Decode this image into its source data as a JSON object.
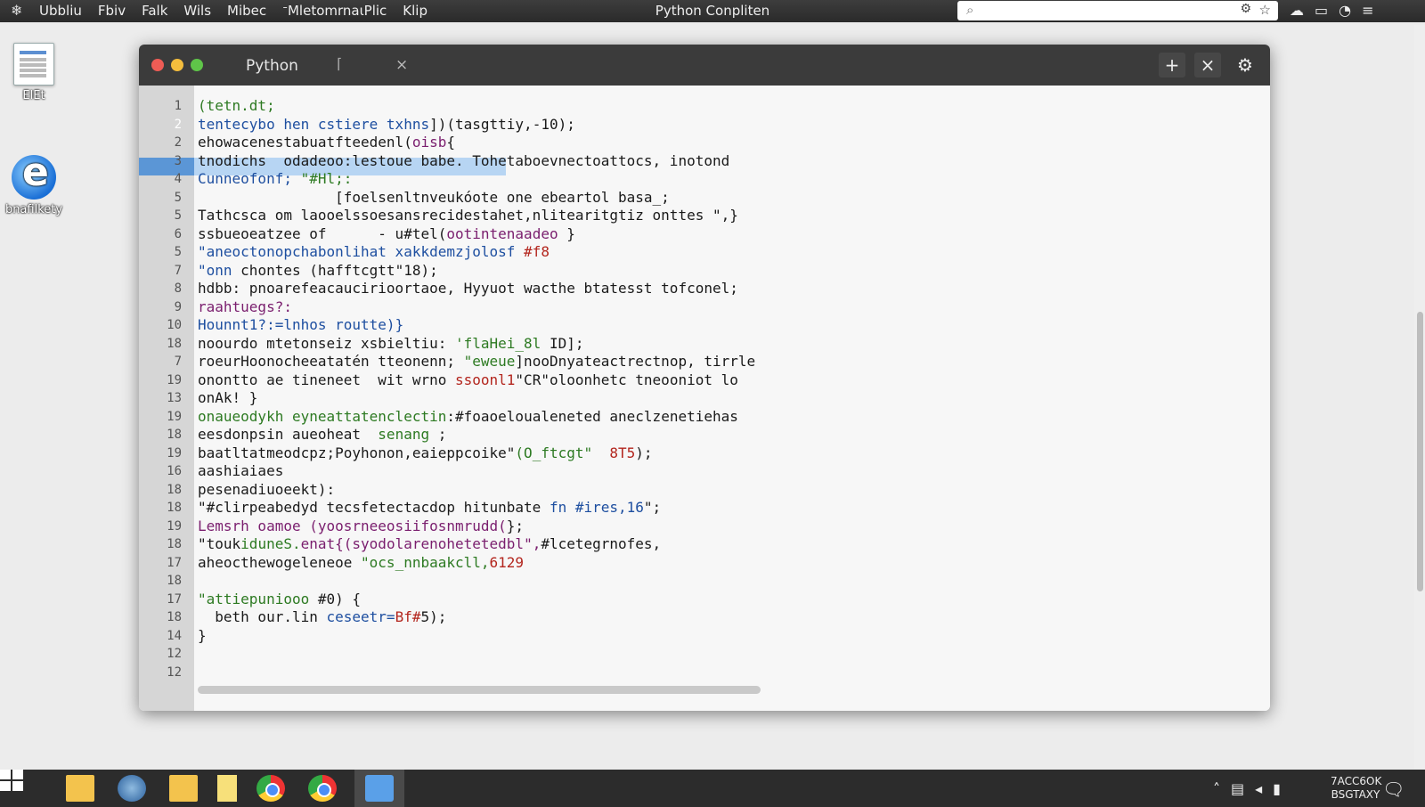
{
  "menubar": {
    "items": [
      "Ubbliu",
      "Fbiv",
      "Falk",
      "Wils",
      "Mibec",
      "ᐨMletomrnaιPlic",
      "Klip"
    ],
    "title": "Python Conpliten"
  },
  "desktop": {
    "icons": [
      {
        "label": "ElEt"
      },
      {
        "label": "bnafilkety"
      }
    ]
  },
  "window": {
    "tab_title": "Python",
    "tab_pin": "⌈",
    "tab_close": "×",
    "btn_pin": "+",
    "btn_close": "×",
    "btn_gear": "⚙"
  },
  "editor": {
    "line_numbers": [
      "1",
      "2",
      "2",
      "3",
      "4",
      "5",
      "5",
      "6",
      "5",
      "7",
      "8",
      "9",
      "10",
      "18",
      "7",
      "19",
      "13",
      "19",
      "18",
      "19",
      "16",
      "18",
      "18",
      "19",
      "18",
      "17",
      "18",
      "17",
      "18",
      "14",
      "12",
      "12"
    ],
    "lines": [
      [
        {
          "t": "(tetn.dt;",
          "c": "g"
        }
      ],
      [
        {
          "t": "tentecybo hen cstiere txhns",
          "c": "b"
        },
        {
          "t": "])(tasgttiy,-10);",
          "c": "k"
        }
      ],
      [
        {
          "t": "ehowacenestabuatfteedenl(",
          "c": "k"
        },
        {
          "t": "oisb",
          "c": "p"
        },
        {
          "t": "{",
          "c": "k"
        }
      ],
      [
        {
          "t": "tnodichs  odadeoo:lestoue babe. Tohetaboevnectoattocs, inotond",
          "c": "k"
        }
      ],
      [
        {
          "t": "Cunneofonf; ",
          "c": "b"
        },
        {
          "t": "\"#Hl;:",
          "c": "g"
        }
      ],
      [
        {
          "t": "                [foelsenltnveukóote one ebeartol basa_;",
          "c": "k"
        }
      ],
      [
        {
          "t": "Tathcsca om laooelssoesansrecidestahet,nlitearitgtiz onttes \",}",
          "c": "k"
        }
      ],
      [
        {
          "t": "ssbueoeatzee of      - u#tel(",
          "c": "k"
        },
        {
          "t": "ootintenaadeo",
          "c": "p"
        },
        {
          "t": " }",
          "c": "k"
        }
      ],
      [
        {
          "t": "\"aneoctonopchabonlihat xakkdemzjolosf ",
          "c": "b"
        },
        {
          "t": "#f8",
          "c": "r"
        }
      ],
      [
        {
          "t": "\"onn ",
          "c": "b"
        },
        {
          "t": "chontes (hafftcgtt\"18);",
          "c": "k"
        }
      ],
      [
        {
          "t": "hdbb: pnoarefeacaucirioortaoe, Hyyuot wacthe btatesst tofconel;",
          "c": "k"
        }
      ],
      [
        {
          "t": "raahtuegs?:",
          "c": "p"
        }
      ],
      [
        {
          "t": "Hounnt1?:",
          "c": "b"
        },
        {
          "t": "=lnhos routte)}",
          "c": "b"
        }
      ],
      [
        {
          "t": "noourdo mtetonseiz xsbieltiu: ",
          "c": "k"
        },
        {
          "t": "'flaHei_8l",
          "c": "g"
        },
        {
          "t": " ID];",
          "c": "k"
        }
      ],
      [
        {
          "t": "roeurHoonocheeatatén tteonenn; ",
          "c": "k"
        },
        {
          "t": "\"eweue",
          "c": "g"
        },
        {
          "t": "]nooDnyateactrectnop, tirrle",
          "c": "k"
        }
      ],
      [
        {
          "t": "onontto ae tineneet  wit wrno ",
          "c": "k"
        },
        {
          "t": "ssoonl1",
          "c": "r"
        },
        {
          "t": "\"CR\"oloonhetc tneooniot lo",
          "c": "k"
        }
      ],
      [
        {
          "t": "onAk! }",
          "c": "k"
        }
      ],
      [
        {
          "t": "onaueodykh eyneattatenclectin",
          "c": "g"
        },
        {
          "t": ":#f",
          "c": "k"
        },
        {
          "t": "oaoeloualeneted aneclzenetiehas",
          "c": "k"
        }
      ],
      [
        {
          "t": "eesdonpsin aueoheat  ",
          "c": "k"
        },
        {
          "t": "senang",
          "c": "g"
        },
        {
          "t": " ;",
          "c": "k"
        }
      ],
      [
        {
          "t": "baatltatmeodcpz;Poyhonon,eaieppcoike\"",
          "c": "k"
        },
        {
          "t": "(O_ftcgt\"",
          "c": "g"
        },
        {
          "t": "  ",
          "c": "k"
        },
        {
          "t": "8T5",
          "c": "r"
        },
        {
          "t": ");",
          "c": "k"
        }
      ],
      [
        {
          "t": "aashiaiaes",
          "c": "k"
        }
      ],
      [
        {
          "t": "pesenadiuoeekt):",
          "c": "k"
        }
      ],
      [
        {
          "t": "\"#clirpeabedyd tecsfetectacdop hitunbate ",
          "c": "k"
        },
        {
          "t": "fn #ires,16",
          "c": "b"
        },
        {
          "t": "\";",
          "c": "k"
        }
      ],
      [
        {
          "t": "Lemsrh oamoe (yoosrneeosiifosnmrudd(",
          "c": "p"
        },
        {
          "t": "};",
          "c": "k"
        }
      ],
      [
        {
          "t": "\"touk",
          "c": "k"
        },
        {
          "t": "iduneS.",
          "c": "g"
        },
        {
          "t": "enat{(syodolarenohetetedbl\",",
          "c": "p"
        },
        {
          "t": "#lcetegrnofes,",
          "c": "k"
        }
      ],
      [
        {
          "t": "aheocthewogeleneoe ",
          "c": "k"
        },
        {
          "t": "\"ocs_nnbaakcll,",
          "c": "g"
        },
        {
          "t": "6129",
          "c": "r"
        }
      ],
      [
        {
          "t": "",
          "c": "k"
        }
      ],
      [
        {
          "t": "\"attiepuniooo ",
          "c": "g"
        },
        {
          "t": "#0) {",
          "c": "k"
        }
      ],
      [
        {
          "t": "  beth our.lin ",
          "c": "k"
        },
        {
          "t": "ceseetr=",
          "c": "b"
        },
        {
          "t": "Bf#",
          "c": "r"
        },
        {
          "t": "5);",
          "c": "k"
        }
      ],
      [
        {
          "t": "}",
          "c": "k"
        }
      ],
      [
        {
          "t": "",
          "c": "k"
        }
      ],
      [
        {
          "t": "",
          "c": "k"
        }
      ]
    ]
  },
  "syntax_colors": {
    "k": "#1a1a1a",
    "b": "#1e4fa0",
    "g": "#2d7a22",
    "p": "#7a1e6e",
    "r": "#b3261e"
  },
  "taskbar": {
    "clock_line1": "7ACC6OK",
    "clock_line2": "BSGTAXY"
  }
}
